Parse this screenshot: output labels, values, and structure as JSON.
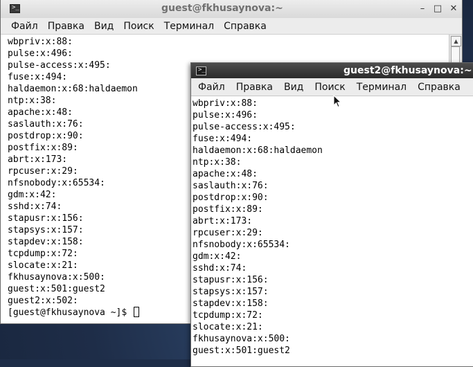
{
  "window1": {
    "title": "guest@fkhusaynova:~",
    "controls": {
      "minimize": "–",
      "maximize": "□",
      "close": "✕"
    },
    "menu": [
      "Файл",
      "Правка",
      "Вид",
      "Поиск",
      "Терминал",
      "Справка"
    ],
    "lines": [
      "wbpriv:x:88:",
      "pulse:x:496:",
      "pulse-access:x:495:",
      "fuse:x:494:",
      "haldaemon:x:68:haldaemon",
      "ntp:x:38:",
      "apache:x:48:",
      "saslauth:x:76:",
      "postdrop:x:90:",
      "postfix:x:89:",
      "abrt:x:173:",
      "rpcuser:x:29:",
      "nfsnobody:x:65534:",
      "gdm:x:42:",
      "sshd:x:74:",
      "stapusr:x:156:",
      "stapsys:x:157:",
      "stapdev:x:158:",
      "tcpdump:x:72:",
      "slocate:x:21:",
      "fkhusaynova:x:500:",
      "guest:x:501:guest2",
      "guest2:x:502:"
    ],
    "prompt": "[guest@fkhusaynova ~]$ "
  },
  "window2": {
    "title": "guest2@fkhusaynova:~",
    "menu": [
      "Файл",
      "Правка",
      "Вид",
      "Поиск",
      "Терминал",
      "Справка"
    ],
    "lines": [
      "wbpriv:x:88:",
      "pulse:x:496:",
      "pulse-access:x:495:",
      "fuse:x:494:",
      "haldaemon:x:68:haldaemon",
      "ntp:x:38:",
      "apache:x:48:",
      "saslauth:x:76:",
      "postdrop:x:90:",
      "postfix:x:89:",
      "abrt:x:173:",
      "rpcuser:x:29:",
      "nfsnobody:x:65534:",
      "gdm:x:42:",
      "sshd:x:74:",
      "stapusr:x:156:",
      "stapsys:x:157:",
      "stapdev:x:158:",
      "tcpdump:x:72:",
      "slocate:x:21:",
      "fkhusaynova:x:500:",
      "guest:x:501:guest2"
    ]
  },
  "icons": {
    "terminal": "terminal-icon",
    "pointer": "mouse-pointer-icon"
  }
}
